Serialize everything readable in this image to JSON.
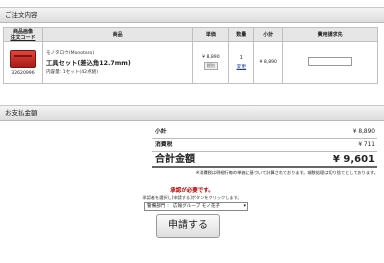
{
  "order_section": {
    "title": "ご注文内容",
    "headers": {
      "code_line1": "商品画像",
      "code_line2": "注文コード",
      "product": "商品",
      "unit_price": "単価",
      "quantity": "数量",
      "subtotal": "小計",
      "budget_code": "費用請求先"
    },
    "item": {
      "code": "32620996",
      "brand": "モノタロウ(Monotaro)",
      "name": "工具セット(差込角12.7mm)",
      "content": "内容量: 1セット(42点組)",
      "unit_price": "¥ 8,890",
      "tax_badge": "税別",
      "quantity": "1",
      "change_link": "変更",
      "subtotal": "¥ 8,890",
      "budget_value": ""
    }
  },
  "payment_section": {
    "title": "お支払金額",
    "subtotal_label": "小計",
    "subtotal_value": "¥ 8,890",
    "tax_label": "消費税",
    "tax_value": "¥ 711",
    "total_label": "合計金額",
    "total_value": "¥ 9,601",
    "note": "※消費税は明細行毎の単価に基づいて計算されております。端数処理は切り捨てとしております。"
  },
  "approval": {
    "notice": "承認が必要です。",
    "instruction": "承認者を選択し[申請する]ボタンをクリックします。",
    "approver_selected": "警備部門 ： 広報グループ モノ花子",
    "apply_label": "申請する"
  }
}
